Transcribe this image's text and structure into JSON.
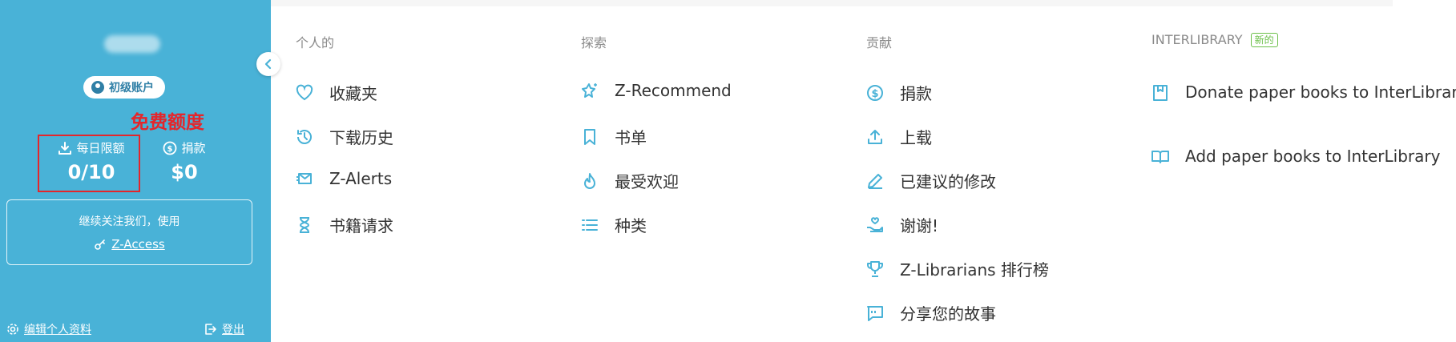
{
  "sidebar": {
    "account_badge": "初级账户",
    "free_quota_note": "免费额度",
    "daily_limit": {
      "label": "每日限额",
      "value": "0/10"
    },
    "donate": {
      "label": "捐款",
      "value": "$0"
    },
    "follow_text": "继续关注我们，使用",
    "follow_link": "Z-Access",
    "profile_link": "编辑个人资料",
    "logout_link": "登出",
    "colors": {
      "background": "#49b2d7",
      "highlight_box": "#e4262b"
    }
  },
  "columns": [
    {
      "title": "个人的",
      "items": [
        {
          "label": "收藏夹",
          "icon": "heart-icon"
        },
        {
          "label": "下载历史",
          "icon": "history-icon"
        },
        {
          "label": "Z-Alerts",
          "icon": "mail-alert-icon"
        },
        {
          "label": "书籍请求",
          "icon": "hourglass-icon"
        }
      ]
    },
    {
      "title": "探索",
      "items": [
        {
          "label": "Z-Recommend",
          "icon": "sparkle-star-icon"
        },
        {
          "label": "书单",
          "icon": "bookmark-icon"
        },
        {
          "label": "最受欢迎",
          "icon": "flame-icon"
        },
        {
          "label": "种类",
          "icon": "list-icon"
        }
      ]
    },
    {
      "title": "贡献",
      "items": [
        {
          "label": "捐款",
          "icon": "dollar-circle-icon"
        },
        {
          "label": "上载",
          "icon": "upload-icon"
        },
        {
          "label": "已建议的修改",
          "icon": "pencil-icon"
        },
        {
          "label": "谢谢!",
          "icon": "hand-heart-icon"
        },
        {
          "label": "Z-Librarians 排行榜",
          "icon": "trophy-icon"
        },
        {
          "label": "分享您的故事",
          "icon": "quote-bubble-icon"
        }
      ]
    },
    {
      "title": "INTERLIBRARY",
      "badge": "新的",
      "items": [
        {
          "label": "Donate paper books to InterLibrary",
          "icon": "book-save-icon"
        },
        {
          "label": "Add paper books to InterLibrary",
          "icon": "open-book-icon"
        }
      ]
    }
  ]
}
